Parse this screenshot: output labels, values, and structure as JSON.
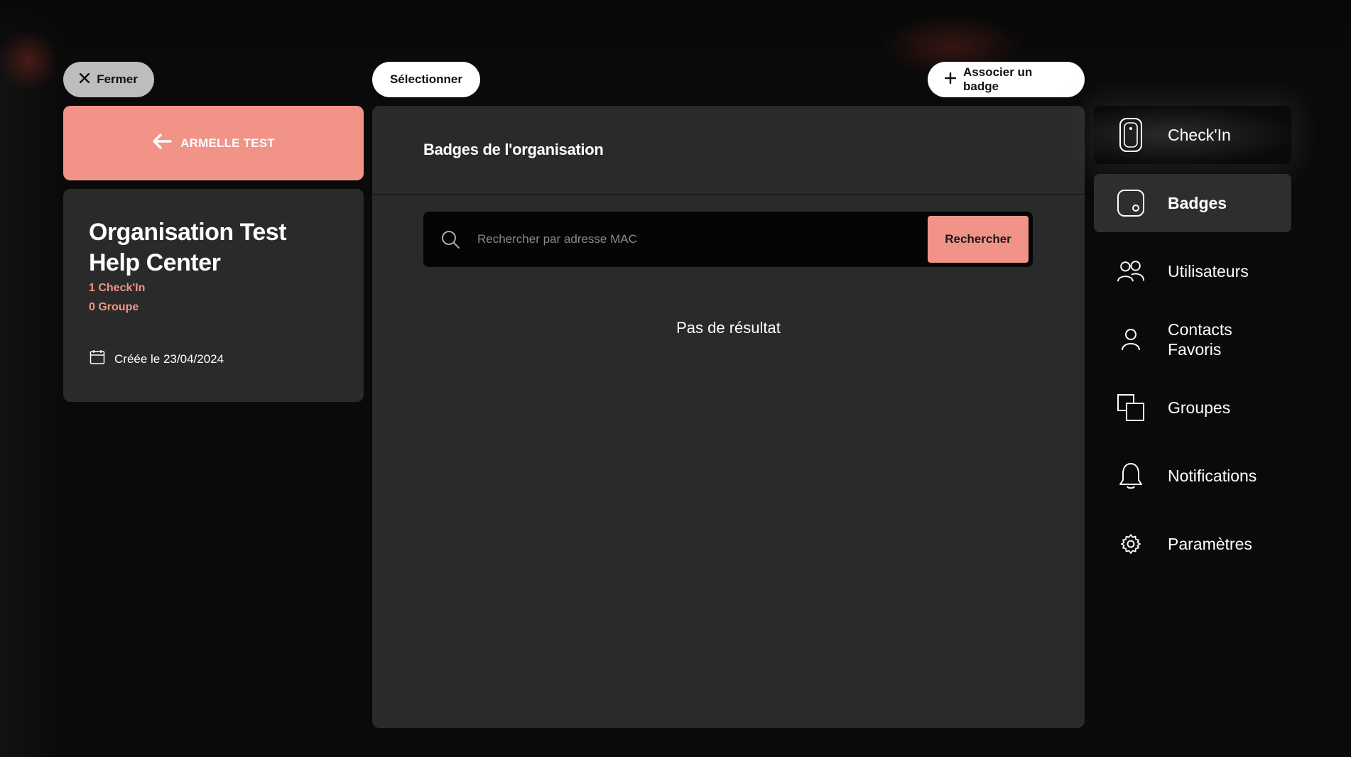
{
  "toolbar": {
    "close_label": "Fermer",
    "select_label": "Sélectionner",
    "associate_label": "Associer un badge"
  },
  "back": {
    "label": "ARMELLE TEST"
  },
  "organisation": {
    "name": "Organisation Test Help Center",
    "checkins": "1 Check'In",
    "groups": "0 Groupe",
    "created": "Créée le 23/04/2024"
  },
  "main": {
    "title": "Badges de l'organisation",
    "search": {
      "placeholder": "Rechercher par adresse MAC",
      "button_label": "Rechercher"
    },
    "empty_message": "Pas de résultat"
  },
  "sidebar": {
    "items": [
      {
        "label": "Check'In",
        "icon": "checkin-device-icon"
      },
      {
        "label": "Badges",
        "icon": "badge-icon"
      },
      {
        "label": "Utilisateurs",
        "icon": "users-icon"
      },
      {
        "label": "Contacts Favoris",
        "icon": "contact-icon"
      },
      {
        "label": "Groupes",
        "icon": "groups-icon"
      },
      {
        "label": "Notifications",
        "icon": "bell-icon"
      },
      {
        "label": "Paramètres",
        "icon": "gear-icon"
      }
    ],
    "active": "Badges"
  },
  "colors": {
    "accent": "#f29387",
    "panel": "#2a2a2a",
    "background": "#0a0a0a"
  }
}
